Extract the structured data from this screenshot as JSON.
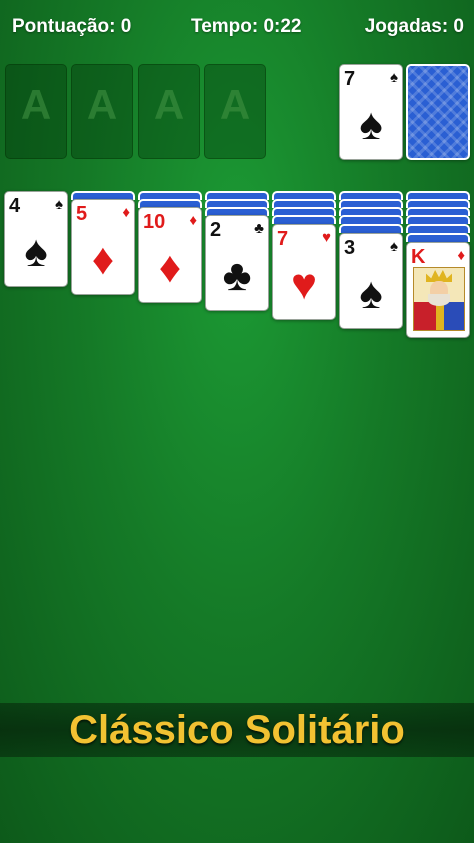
{
  "hud": {
    "score": "Pontuação: 0",
    "time": "Tempo: 0:22",
    "moves": "Jogadas: 0"
  },
  "foundations": [
    "A",
    "A",
    "A",
    "A"
  ],
  "waste": {
    "rank": "7",
    "suit": "♠",
    "color": "black"
  },
  "stock": {
    "face_down": true
  },
  "tableau": [
    {
      "hidden": 0,
      "rank": "4",
      "suit": "♠",
      "color": "black"
    },
    {
      "hidden": 1,
      "rank": "5",
      "suit": "♦",
      "color": "red"
    },
    {
      "hidden": 2,
      "rank": "10",
      "suit": "♦",
      "color": "red"
    },
    {
      "hidden": 3,
      "rank": "2",
      "suit": "♣",
      "color": "black"
    },
    {
      "hidden": 4,
      "rank": "7",
      "suit": "♥",
      "color": "red"
    },
    {
      "hidden": 5,
      "rank": "3",
      "suit": "♠",
      "color": "black"
    },
    {
      "hidden": 6,
      "rank": "K",
      "suit": "♦",
      "color": "red"
    }
  ],
  "banner": "Clássico Solitário",
  "colors": {
    "felt": "#157a27",
    "red_suit": "#e01b1b",
    "card_back": "#2a5fd3",
    "banner_text": "#f2c232"
  }
}
